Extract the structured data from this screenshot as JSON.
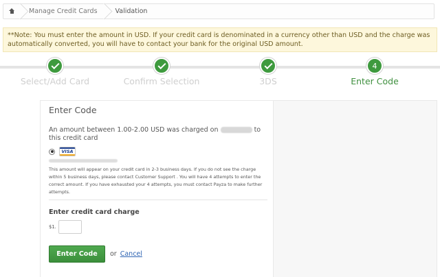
{
  "breadcrumb": {
    "home_icon": "home-icon",
    "items": [
      "Manage Credit Cards",
      "Validation"
    ]
  },
  "note": {
    "text": "**Note: You must enter the amount in USD. If your credit card is denominated in a currency other than USD and the charge was automatically converted, you will have to contact your bank for the original USD amount."
  },
  "progress": {
    "steps": [
      {
        "label": "Select/Add Card",
        "state": "done"
      },
      {
        "label": "Confirm Selection",
        "state": "done"
      },
      {
        "label": "3DS",
        "state": "done"
      },
      {
        "label": "Enter Code",
        "number": "4",
        "state": "active"
      }
    ],
    "accent": "#3e9a3e"
  },
  "main": {
    "title": "Enter Code",
    "charge_text_before": "An amount between 1.00-2.00 USD was charged on",
    "charge_text_after": "to this credit card",
    "card_brand": "VISA",
    "info_text": "This amount will appear on your credit card in 2-3 business days. If you do not see the charge within 5 business days, please contact Customer Support . You will have 4 attempts to enter the correct amount. If you have exhausted your 4 attempts, you must contact Payza to make further attempts.",
    "field_label": "Enter credit card charge",
    "currency_prefix": "$1.",
    "input_value": "",
    "submit_label": "Enter Code",
    "or_text": "or",
    "cancel_label": "Cancel"
  }
}
